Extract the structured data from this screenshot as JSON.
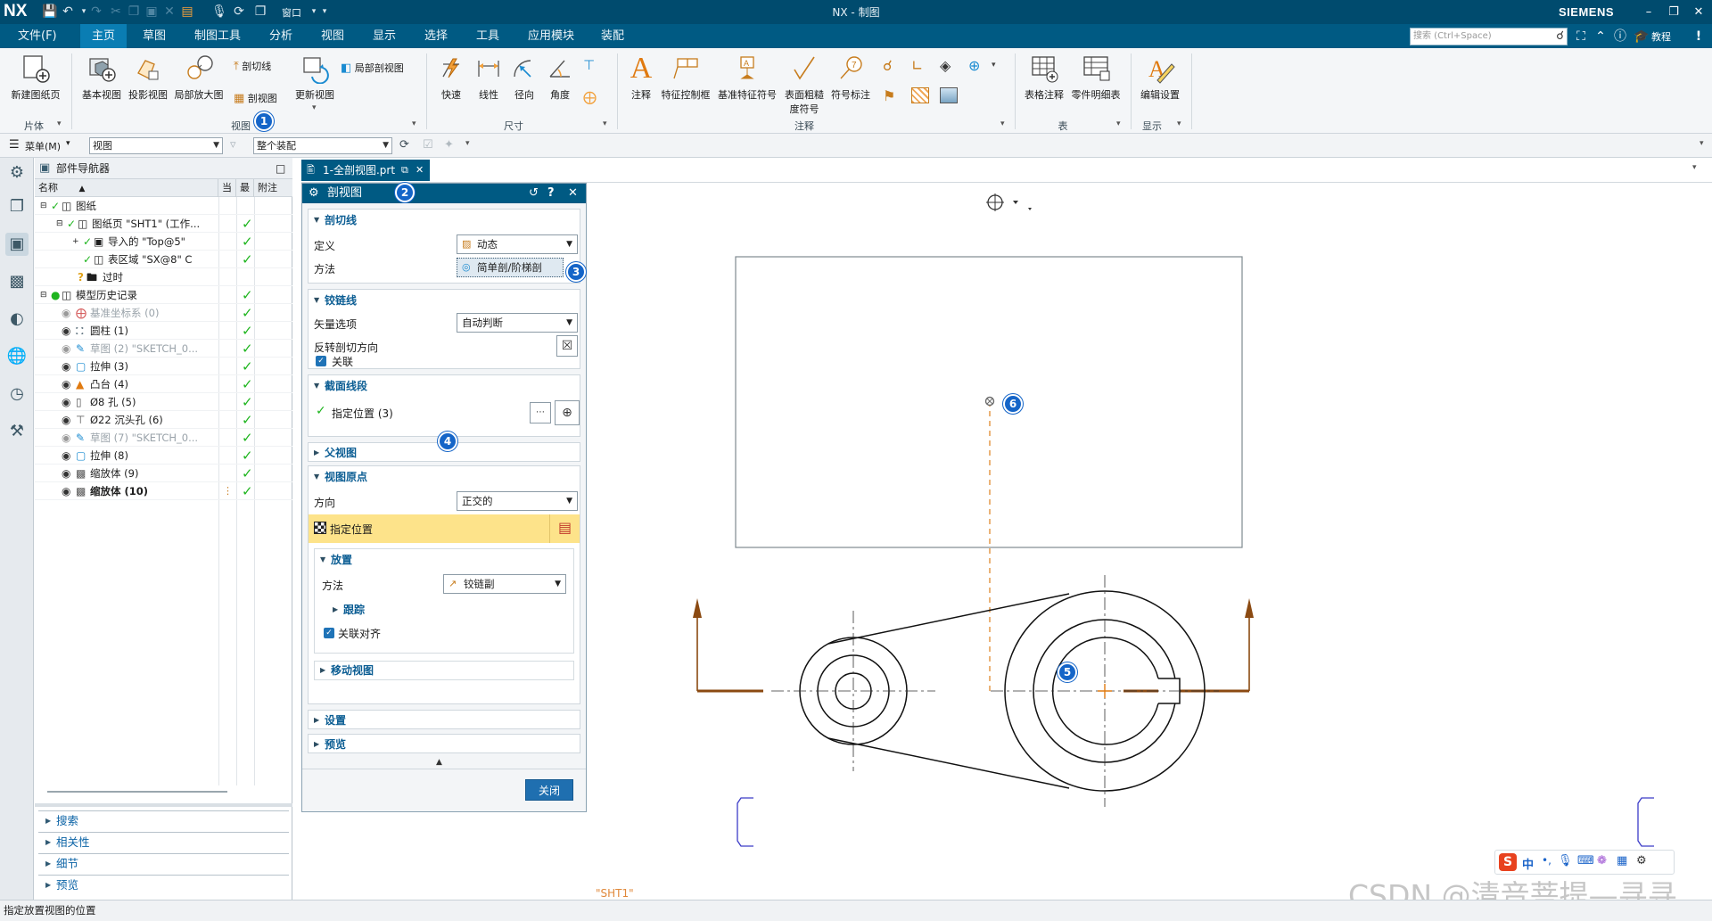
{
  "titlebar": {
    "logo": "NX",
    "window_label": "窗口",
    "title": "NX - 制图",
    "brand": "SIEMENS"
  },
  "menubar": {
    "items": [
      "文件(F)",
      "主页",
      "草图",
      "制图工具",
      "分析",
      "视图",
      "显示",
      "选择",
      "工具",
      "应用模块",
      "装配"
    ],
    "active": "主页",
    "search_placeholder": "搜索 (Ctrl+Space)",
    "tutorial": "教程"
  },
  "ribbon": {
    "groups": {
      "sheet": "片体",
      "view": "视图",
      "dimension": "尺寸",
      "annotation": "注释",
      "table": "表",
      "display": "显示"
    },
    "buttons": {
      "new_sheet": "新建图纸页",
      "base_view": "基本视图",
      "projected_view": "投影视图",
      "detail_view": "局部放大图",
      "section_line": "剖切线",
      "section_view": "剖视图",
      "update_view": "更新视图",
      "break_out_view": "局部剖视图",
      "rapid": "快速",
      "linear": "线性",
      "radial": "径向",
      "angular": "角度",
      "note": "注释",
      "feature_frame": "特征控制框",
      "datum_symbol": "基准特征符号",
      "surface_finish_1": "表面粗糙",
      "surface_finish_2": "度符号",
      "balloon": "符号标注",
      "tabular_note": "表格注释",
      "parts_list": "零件明细表",
      "edit_settings": "编辑设置"
    }
  },
  "selbar": {
    "menu": "菜单(M)",
    "filter": "视图",
    "scope": "整个装配"
  },
  "navigator": {
    "title": "部件导航器",
    "columns": {
      "name": "名称",
      "current": "当",
      "latest": "最",
      "attached": "附注"
    },
    "rows": [
      {
        "label": "图纸"
      },
      {
        "label": "图纸页 \"SHT1\" (工作..."
      },
      {
        "label": "导入的 \"Top@5\""
      },
      {
        "label": "表区域 \"SX@8\" C"
      },
      {
        "label": "过时"
      },
      {
        "label": "模型历史记录"
      },
      {
        "label": "基准坐标系 (0)"
      },
      {
        "label": "圆柱 (1)"
      },
      {
        "label": "草图 (2) \"SKETCH_0..."
      },
      {
        "label": "拉伸 (3)"
      },
      {
        "label": "凸台 (4)"
      },
      {
        "label": "Ø8 孔 (5)"
      },
      {
        "label": "Ø22 沉头孔 (6)"
      },
      {
        "label": "草图 (7) \"SKETCH_0..."
      },
      {
        "label": "拉伸 (8)"
      },
      {
        "label": "缩放体 (9)"
      },
      {
        "label": "缩放体 (10)"
      }
    ],
    "sections": [
      "搜索",
      "相关性",
      "细节",
      "预览"
    ]
  },
  "filetab": {
    "label": "1-全剖视图.prt"
  },
  "dialog": {
    "title": "剖视图",
    "section_line": {
      "header": "剖切线",
      "definition_label": "定义",
      "definition_value": "动态",
      "method_label": "方法",
      "method_value": "简单剖/阶梯剖"
    },
    "hinge_line": {
      "header": "铰链线",
      "vector_label": "矢量选项",
      "vector_value": "自动判断",
      "reverse_label": "反转剖切方向",
      "associative_label": "关联"
    },
    "section_segment": {
      "header": "截面线段",
      "specify_location": "指定位置 (3)"
    },
    "parent_view": {
      "header": "父视图"
    },
    "view_origin": {
      "header": "视图原点",
      "orientation_label": "方向",
      "orientation_value": "正交的",
      "specify_location": "指定位置",
      "placement": {
        "header": "放置",
        "method_label": "方法",
        "method_value": "铰链副",
        "track": "跟踪",
        "align_label": "关联对齐"
      },
      "move_view": "移动视图"
    },
    "settings": {
      "header": "设置"
    },
    "preview": {
      "header": "预览"
    },
    "close_button": "关闭"
  },
  "graphics": {
    "sheet_label": "\"SHT1\""
  },
  "callouts": [
    "1",
    "2",
    "3",
    "4",
    "5",
    "6"
  ],
  "statusbar": {
    "message": "指定放置视图的位置"
  },
  "watermark": "CSDN @清音菩提—寻寻",
  "ime": {
    "label": "中"
  },
  "colors": {
    "title_bg": "#004b6e",
    "menu_bg": "#005a83",
    "accent": "#0a7db3",
    "callout": "#1565c8",
    "section_arrow": "#8b4a12",
    "highlight_row": "#fde38a",
    "check_green": "#1fb51f"
  }
}
